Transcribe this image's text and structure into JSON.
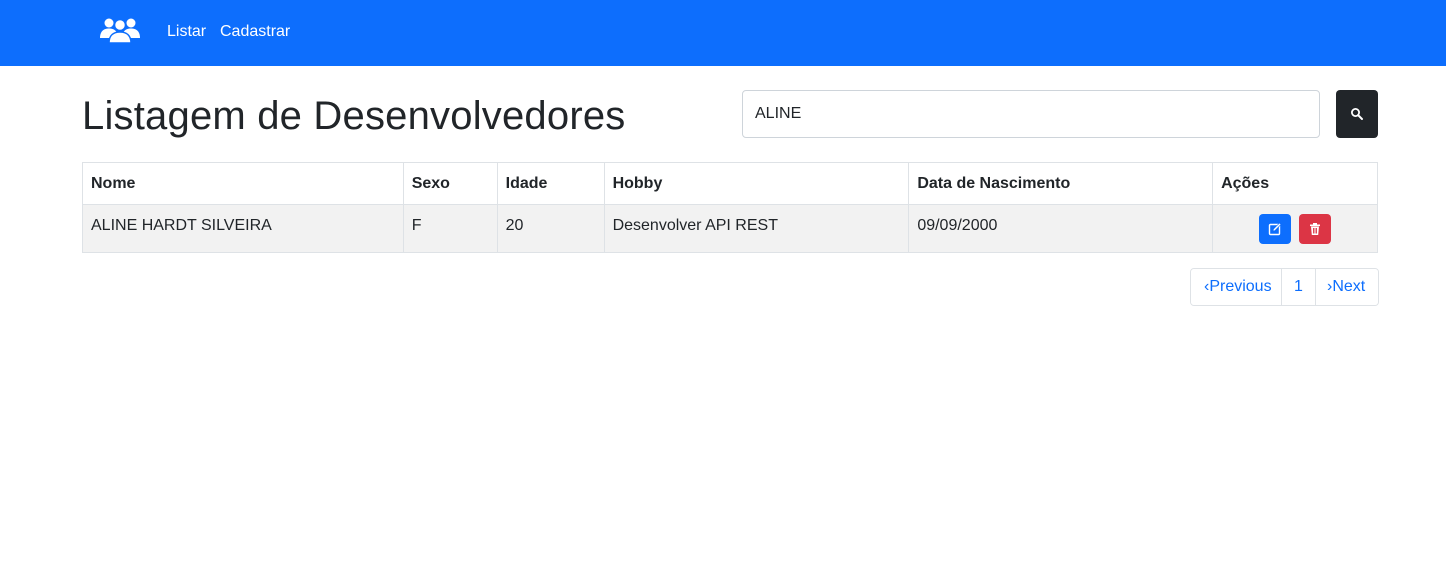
{
  "navbar": {
    "brand_icon": "users-group-icon",
    "links": [
      {
        "label": "Listar"
      },
      {
        "label": "Cadastrar"
      }
    ],
    "background": "#0d6efd"
  },
  "page": {
    "title": "Listagem de Desenvolvedores"
  },
  "search": {
    "value": "ALINE",
    "button_icon": "search-icon"
  },
  "table": {
    "headers": [
      "Nome",
      "Sexo",
      "Idade",
      "Hobby",
      "Data de Nascimento",
      "Ações"
    ],
    "rows": [
      {
        "nome": "ALINE HARDT SILVEIRA",
        "sexo": "F",
        "idade": "20",
        "hobby": "Desenvolver API REST",
        "data_nascimento": "09/09/2000",
        "actions": [
          "edit-icon",
          "trash-icon"
        ]
      }
    ]
  },
  "pagination": {
    "previous": "‹Previous",
    "current": "1",
    "next": "›Next"
  },
  "colors": {
    "primary": "#0d6efd",
    "danger": "#dc3545",
    "dark": "#212529"
  }
}
